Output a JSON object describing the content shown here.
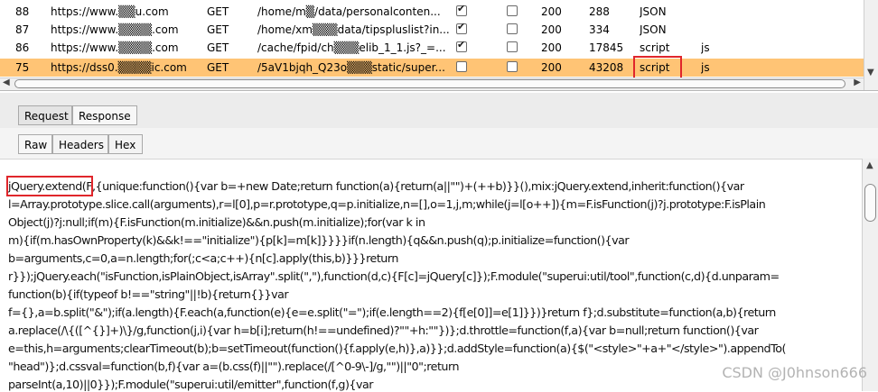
{
  "history": {
    "rows": [
      {
        "num": "88",
        "host": "https://www.▒▒u.com",
        "method": "GET",
        "url": "/home/m▒/data/personalconten...",
        "params": true,
        "edited": false,
        "status": "200",
        "length": "288",
        "mime": "JSON",
        "ext": ""
      },
      {
        "num": "87",
        "host": "https://www.▒▒▒▒.com",
        "method": "GET",
        "url": "/home/xm▒▒▒data/tipspluslist?in...",
        "params": true,
        "edited": false,
        "status": "200",
        "length": "334",
        "mime": "JSON",
        "ext": ""
      },
      {
        "num": "86",
        "host": "https://www.▒▒▒▒.com",
        "method": "GET",
        "url": "/cache/fpid/ch▒▒▒elib_1_1.js?_=...",
        "params": true,
        "edited": false,
        "status": "200",
        "length": "17845",
        "mime": "script",
        "ext": "js"
      },
      {
        "num": "75",
        "host": "https://dss0.▒▒▒▒ic.com",
        "method": "GET",
        "url": "/5aV1bjqh_Q23o▒▒▒static/super...",
        "params": false,
        "edited": false,
        "status": "200",
        "length": "43208",
        "mime": "script",
        "ext": "js"
      }
    ]
  },
  "tabs": {
    "request": "Request",
    "response": "Response"
  },
  "subtabs": {
    "raw": "Raw",
    "headers": "Headers",
    "hex": "Hex"
  },
  "body": {
    "lines": [
      "jQuery.extend(F,{unique:function(){var b=+new Date;return function(a){return(a||\"\")+(++b)}}(),mix:jQuery.extend,inherit:function(){var",
      "l=Array.prototype.slice.call(arguments),r=l[0],p=r.prototype,q=p.initialize,n=[],o=1,j,m;while(j=l[o++]){m=F.isFunction(j)?j.prototype:F.isPlain",
      "Object(j)?j:null;if(m){F.isFunction(m.initialize)&&n.push(m.initialize);for(var k in",
      "m){if(m.hasOwnProperty(k)&&k!==\"initialize\"){p[k]=m[k]}}}}if(n.length){q&&n.push(q);p.initialize=function(){var",
      "b=arguments,c=0,a=n.length;for(;c<a;c++){n[c].apply(this,b)}}}return",
      "r}});jQuery.each(\"isFunction,isPlainObject,isArray\".split(\",\"),function(d,c){F[c]=jQuery[c]});F.module(\"superui:util/tool\",function(c,d){d.unparam=",
      "function(b){if(typeof b!==\"string\"||!b){return{}}var",
      "f={},a=b.split(\"&\");if(a.length){F.each(a,function(e){e=e.split(\"=\");if(e.length==2){f[e[0]]=e[1]}})}return f};d.substitute=function(a,b){return",
      "a.replace(/\\{([^{}]+)\\}/g,function(j,i){var h=b[i];return(h!==undefined)?\"\"+h:\"\"})};d.throttle=function(f,a){var b=null;return function(){var",
      "e=this,h=arguments;clearTimeout(b);b=setTimeout(function(){f.apply(e,h)},a)}};d.addStyle=function(a){$(\"<style>\"+a+\"</style>\").appendTo(",
      "\"head\")};d.cssval=function(b,f){var a=(b.css(f)||\"\").replace(/[^0-9\\-]/g,\"\")||\"0\";return",
      "parseInt(a,10)||0}});F.module(\"superui:util/emitter\",function(f,g){var"
    ]
  },
  "watermark": "CSDN @J0hnson666"
}
